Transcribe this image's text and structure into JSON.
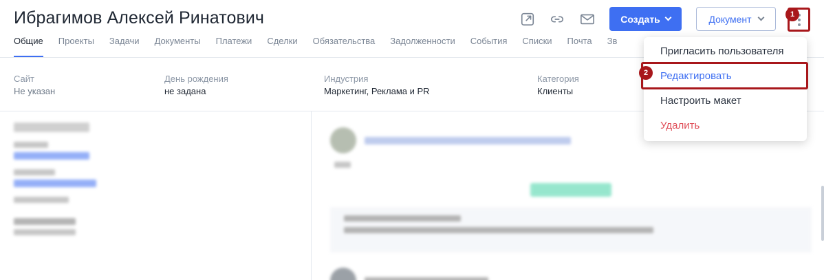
{
  "header": {
    "title": "Ибрагимов Алексей Ринатович",
    "create_label": "Создать",
    "document_label": "Документ"
  },
  "icons": [
    "external-link-icon",
    "link-icon",
    "mail-icon",
    "more-vertical-icon"
  ],
  "tabs": [
    {
      "label": "Общие",
      "active": true
    },
    {
      "label": "Проекты"
    },
    {
      "label": "Задачи"
    },
    {
      "label": "Документы"
    },
    {
      "label": "Платежи"
    },
    {
      "label": "Сделки"
    },
    {
      "label": "Обязательства"
    },
    {
      "label": "Задолженности"
    },
    {
      "label": "События"
    },
    {
      "label": "Списки"
    },
    {
      "label": "Почта"
    },
    {
      "label": "Зв"
    }
  ],
  "fields": [
    {
      "label": "Сайт",
      "value": "Не указан"
    },
    {
      "label": "День рождения",
      "value": "не задана"
    },
    {
      "label": "Индустрия",
      "value": "Маркетинг, Реклама и PR"
    },
    {
      "label": "Категория",
      "value": "Клиенты"
    }
  ],
  "menu": {
    "items": [
      {
        "label": "Пригласить пользователя"
      },
      {
        "label": "Редактировать"
      },
      {
        "label": "Настроить макет"
      },
      {
        "label": "Удалить"
      }
    ]
  },
  "markers": [
    "1",
    "2"
  ],
  "colors": {
    "accent": "#3e6ff2",
    "highlight": "#a8171b",
    "danger": "#e0505a"
  }
}
